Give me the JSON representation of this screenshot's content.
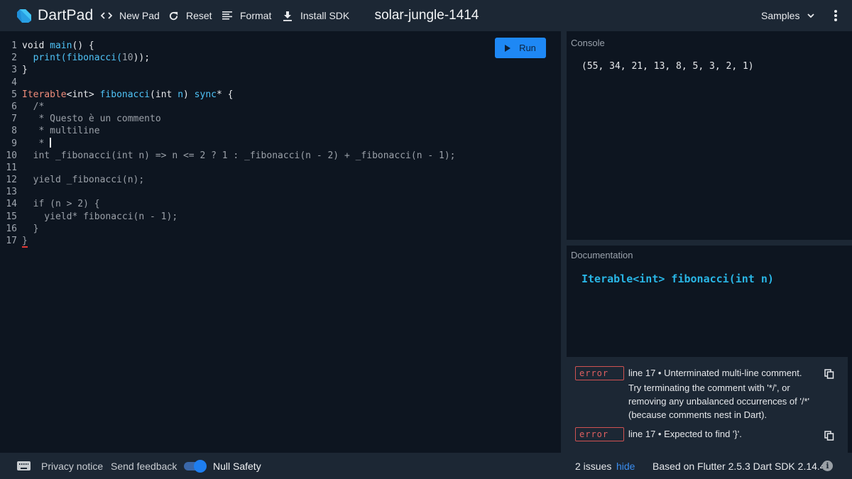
{
  "header": {
    "app_name": "DartPad",
    "buttons": [
      {
        "label": "New Pad",
        "icon": "code-brackets-icon"
      },
      {
        "label": "Reset",
        "icon": "refresh-icon"
      },
      {
        "label": "Format",
        "icon": "format-lines-icon"
      },
      {
        "label": "Install SDK",
        "icon": "download-icon"
      }
    ],
    "pad_title": "solar-jungle-1414",
    "samples_label": "Samples",
    "menu_icon": "more-vert-icon"
  },
  "editor": {
    "run_label": "Run",
    "lines": [
      {
        "n": "1"
      },
      {
        "n": "2"
      },
      {
        "n": "3"
      },
      {
        "n": "4"
      },
      {
        "n": "5"
      },
      {
        "n": "6"
      },
      {
        "n": "7"
      },
      {
        "n": "8"
      },
      {
        "n": "9"
      },
      {
        "n": "10"
      },
      {
        "n": "11"
      },
      {
        "n": "12"
      },
      {
        "n": "13"
      },
      {
        "n": "14"
      },
      {
        "n": "15"
      },
      {
        "n": "16"
      },
      {
        "n": "17"
      }
    ],
    "tokens": {
      "l1a": "void ",
      "l1b": "main",
      "l1c": "() {",
      "l2a": "  ",
      "l2b": "print",
      "l2c": "(",
      "l2d": "fibonacci",
      "l2e": "(",
      "l2f": "10",
      "l2g": "));",
      "l3": "}",
      "l5a": "Iterable",
      "l5b": "<int> ",
      "l5c": "fibonacci",
      "l5d": "(int ",
      "l5e": "n",
      "l5f": ") ",
      "l5g": "sync",
      "l5h": "* {",
      "l6": "  /*",
      "l7": "   * Questo è un commento",
      "l8": "   * multiline",
      "l9": "   * ",
      "l10": "  int _fibonacci(int n) => n <= 2 ? 1 : _fibonacci(n - 2) + _fibonacci(n - 1);",
      "l12": "  yield _fibonacci(n);",
      "l14": "  if (n > 2) {",
      "l15": "    yield* fibonacci(n - 1);",
      "l16": "  }",
      "l17": "}"
    }
  },
  "console": {
    "label": "Console",
    "output": "(55, 34, 21, 13, 8, 5, 3, 2, 1)"
  },
  "documentation": {
    "label": "Documentation",
    "signature": "Iterable<int> fibonacci(int n)"
  },
  "issues": [
    {
      "severity": "error",
      "message": "line 17 • Unterminated multi-line comment.",
      "correction": "Try terminating the comment with '*/', or removing any unbalanced occurrences of '/*' (because comments nest in Dart)."
    },
    {
      "severity": "error",
      "message": "line 17 • Expected to find '}'.",
      "correction": ""
    }
  ],
  "footer": {
    "privacy_label": "Privacy notice",
    "feedback_label": "Send feedback",
    "null_safety_label": "Null Safety",
    "null_safety_enabled": true,
    "issues_count": "2 issues",
    "hide_label": "hide",
    "version_text": "Based on Flutter 2.5.3 Dart SDK 2.14.4"
  },
  "colors": {
    "accent": "#1e88f5",
    "header_bg": "#1c2734",
    "editor_bg": "#0d1520",
    "error": "#d05252",
    "doc_signature": "#29b6e6"
  }
}
